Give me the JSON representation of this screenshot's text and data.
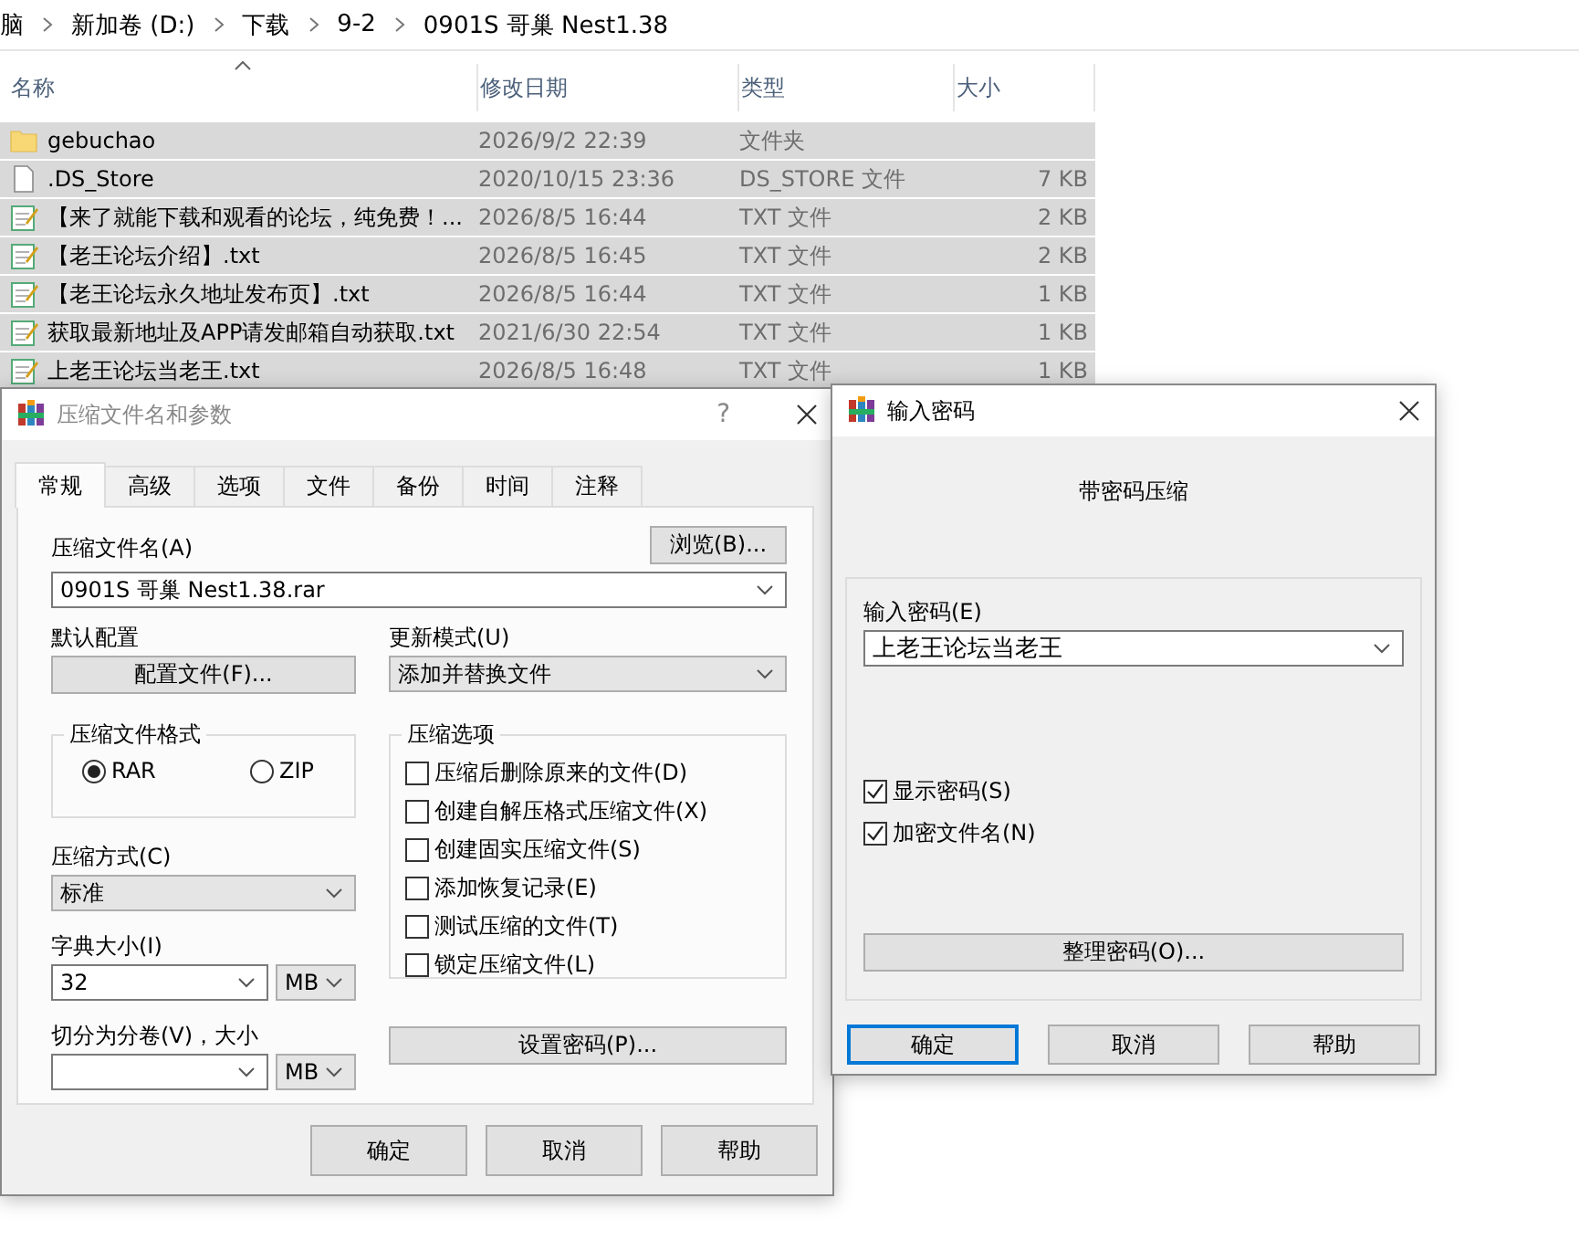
{
  "explorer": {
    "breadcrumb": [
      "脑",
      "新加卷 (D:)",
      "下载",
      "9-2",
      "0901S 哥巢 Nest1.38"
    ],
    "columns": [
      {
        "label": "名称",
        "sorted": true
      },
      {
        "label": "修改日期",
        "sorted": false
      },
      {
        "label": "类型",
        "sorted": false
      },
      {
        "label": "大小",
        "sorted": false
      }
    ],
    "rows": [
      {
        "kind": "folder",
        "name": "gebuchao",
        "date": "2026/9/2 22:39",
        "type": "文件夹",
        "selected": true
      },
      {
        "kind": "file",
        "name": ".DS_Store",
        "date": "2020/10/15 23:36",
        "type": "DS_STORE 文件",
        "size": "7 KB",
        "selected": true
      },
      {
        "kind": "text",
        "name": "【来了就能下载和观看的论坛，纯免费！...",
        "date": "2026/8/5 16:44",
        "type": "TXT 文件",
        "size": "2 KB",
        "selected": true
      },
      {
        "kind": "text",
        "name": "【老王论坛介绍】.txt",
        "date": "2026/8/5 16:45",
        "type": "TXT 文件",
        "size": "2 KB",
        "selected": true
      },
      {
        "kind": "text",
        "name": "【老王论坛永久地址发布页】.txt",
        "date": "2026/8/5 16:44",
        "type": "TXT 文件",
        "size": "1 KB",
        "selected": true
      },
      {
        "kind": "text",
        "name": "获取最新地址及APP请发邮箱自动获取.txt",
        "date": "2021/6/30 22:54",
        "type": "TXT 文件",
        "size": "1 KB",
        "selected": true
      },
      {
        "kind": "text",
        "name": "上老王论坛当老王.txt",
        "date": "2026/8/5 16:48",
        "type": "TXT 文件",
        "size": "1 KB",
        "selected": true
      }
    ]
  },
  "archive_dialog": {
    "title": "压缩文件名和参数",
    "help": "?",
    "tabs": [
      {
        "label": "常规",
        "selected": true
      },
      {
        "label": "高级",
        "selected": false
      },
      {
        "label": "选项",
        "selected": false
      },
      {
        "label": "文件",
        "selected": false
      },
      {
        "label": "备份",
        "selected": false
      },
      {
        "label": "时间",
        "selected": false
      },
      {
        "label": "注释",
        "selected": false
      }
    ],
    "archive_name_label": "压缩文件名(A)",
    "browse_button": "浏览(B)...",
    "archive_name": "0901S 哥巢 Nest1.38.rar",
    "profile_label": "默认配置",
    "profile_button": "配置文件(F)...",
    "update_mode_label": "更新模式(U)",
    "update_mode": "添加并替换文件",
    "format_group": {
      "title": "压缩文件格式",
      "options": [
        {
          "label": "RAR",
          "selected": true
        },
        {
          "label": "ZIP",
          "selected": false
        }
      ]
    },
    "options_group": {
      "title": "压缩选项",
      "options": [
        {
          "label": "压缩后删除原来的文件(D)",
          "checked": false
        },
        {
          "label": "创建自解压格式压缩文件(X)",
          "checked": false
        },
        {
          "label": "创建固实压缩文件(S)",
          "checked": false
        },
        {
          "label": "添加恢复记录(E)",
          "checked": false
        },
        {
          "label": "测试压缩的文件(T)",
          "checked": false
        },
        {
          "label": "锁定压缩文件(L)",
          "checked": false
        }
      ]
    },
    "method_label": "压缩方式(C)",
    "method": "标准",
    "dictionary_label": "字典大小(I)",
    "dictionary": "32",
    "dictionary_unit": "MB",
    "volume_label": "切分为分卷(V)，大小",
    "volume_unit": "MB",
    "password_button": "设置密码(P)...",
    "buttons": [
      "确定",
      "取消",
      "帮助"
    ]
  },
  "password_dialog": {
    "title": "输入密码",
    "heading": "带密码压缩",
    "password_label": "输入密码(E)",
    "password": "上老王论坛当老王",
    "options": [
      {
        "label": "显示密码(S)",
        "checked": true
      },
      {
        "label": "加密文件名(N)",
        "checked": true
      }
    ],
    "organize_button": "整理密码(O)...",
    "buttons": [
      {
        "label": "确定",
        "default": true
      },
      {
        "label": "取消",
        "default": false
      },
      {
        "label": "帮助",
        "default": false
      }
    ]
  }
}
